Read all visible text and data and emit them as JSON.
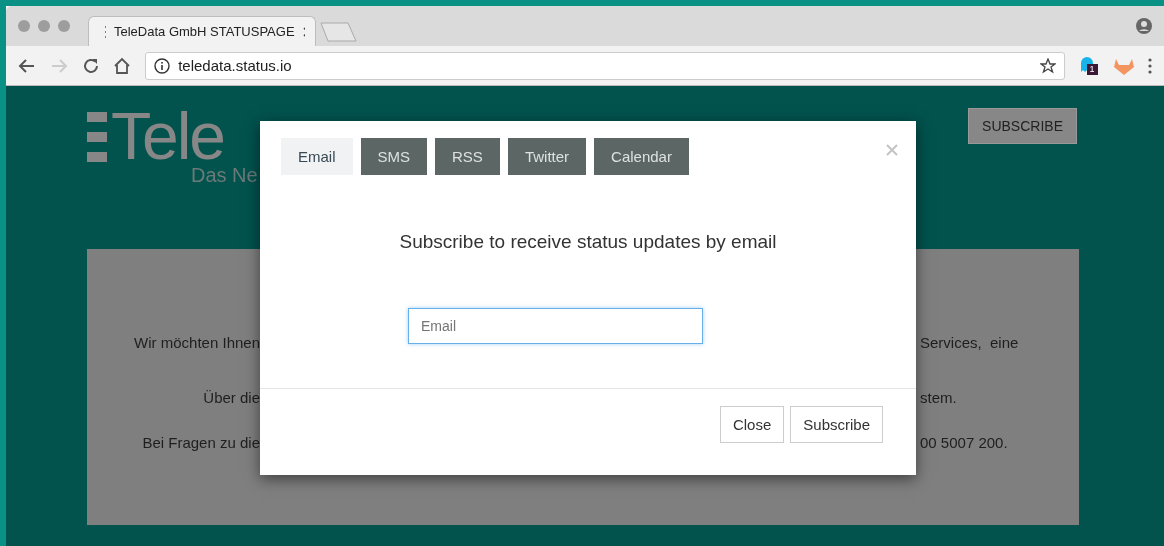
{
  "browser": {
    "tab": {
      "title": "TeleData GmbH STATUSPAGE"
    },
    "url": "teledata.status.io",
    "extension_badge": "1"
  },
  "page": {
    "logo": {
      "word": "Tele",
      "tagline": "Das Ne"
    },
    "subscribe_button": "SUBSCRIBE",
    "notice_lines": [
      {
        "left": "Wir möchten Ihnen",
        "right": "Services,  eine"
      },
      {
        "left": "Über die",
        "right": "stem."
      },
      {
        "left": "Bei Fragen zu die",
        "right": "00 5007 200."
      }
    ]
  },
  "modal": {
    "tabs": [
      {
        "label": "Email",
        "selected": true
      },
      {
        "label": "SMS",
        "selected": false
      },
      {
        "label": "RSS",
        "selected": false
      },
      {
        "label": "Twitter",
        "selected": false
      },
      {
        "label": "Calendar",
        "selected": false
      }
    ],
    "heading": "Subscribe to receive status updates by email",
    "email_field": {
      "placeholder": "Email",
      "focused": true
    },
    "buttons": [
      "Close",
      "Subscribe"
    ]
  }
}
